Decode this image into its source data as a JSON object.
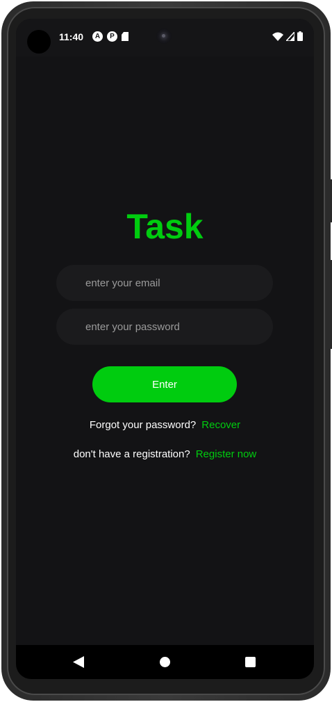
{
  "status_bar": {
    "time": "11:40",
    "left_icons": [
      "a-circle-icon",
      "p-circle-icon",
      "sd-card-icon"
    ],
    "left_icon_glyphs": [
      "A",
      "P"
    ],
    "right_icons": [
      "wifi-icon",
      "signal-icon",
      "battery-icon"
    ]
  },
  "login": {
    "title": "Task",
    "email_placeholder": "enter your email",
    "password_placeholder": "enter your password",
    "enter_label": "Enter",
    "forgot_text": "Forgot your password?",
    "recover_link": "Recover",
    "register_text": "don't have a registration?",
    "register_link": "Register now"
  },
  "nav_bar": {
    "buttons": [
      "back-icon",
      "home-icon",
      "recents-icon"
    ]
  },
  "colors": {
    "accent": "#00cc0f",
    "background": "#131315",
    "field_background": "#1b1b1d",
    "text": "#ffffff",
    "placeholder": "#9b9b9b"
  }
}
